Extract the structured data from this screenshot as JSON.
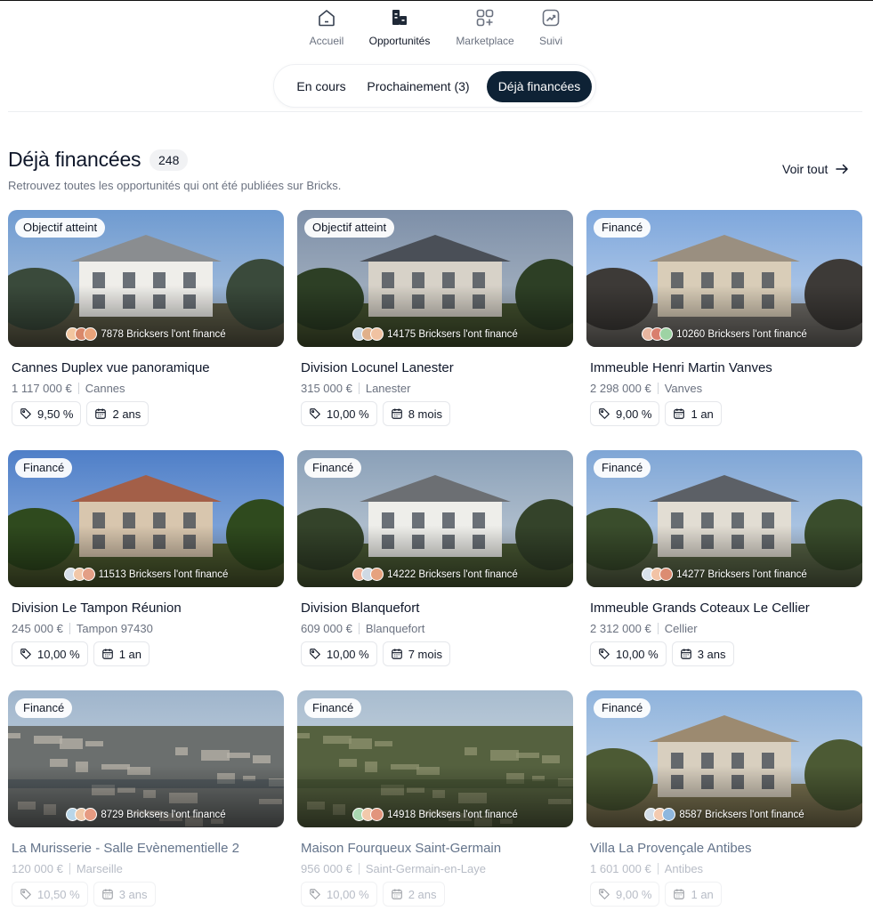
{
  "nav": {
    "items": [
      {
        "label": "Accueil",
        "icon": "home-icon"
      },
      {
        "label": "Opportunités",
        "icon": "opportunities-icon"
      },
      {
        "label": "Marketplace",
        "icon": "marketplace-icon"
      },
      {
        "label": "Suivi",
        "icon": "chart-icon"
      }
    ],
    "active": "Opportunités"
  },
  "tabs": [
    {
      "label": "En cours"
    },
    {
      "label": "Prochainement (3)"
    },
    {
      "label": "Déjà financées"
    }
  ],
  "active_tab": "Déjà financées",
  "section": {
    "title": "Déjà financées",
    "count": "248",
    "subtitle": "Retrouvez toutes les opportunités qui ont été publiées sur Bricks.",
    "see_all": "Voir tout"
  },
  "colors": {
    "accent_dark": "#0e2235",
    "muted_text": "#6b7280"
  },
  "cards": [
    {
      "badge": "Objectif atteint",
      "investors": "7878 Bricksers l'ont financé",
      "title": "Cannes Duplex vue panoramique",
      "price": "1 117 000 €",
      "location": "Cannes",
      "yield": "9,50 %",
      "duration": "2 ans"
    },
    {
      "badge": "Objectif atteint",
      "investors": "14175 Bricksers l'ont financé",
      "title": "Division Locunel Lanester",
      "price": "315 000 €",
      "location": "Lanester",
      "yield": "10,00 %",
      "duration": "8 mois"
    },
    {
      "badge": "Financé",
      "investors": "10260 Bricksers l'ont financé",
      "title": "Immeuble Henri Martin Vanves",
      "price": "2 298 000 €",
      "location": "Vanves",
      "yield": "9,00 %",
      "duration": "1 an"
    },
    {
      "badge": "Financé",
      "investors": "11513 Bricksers l'ont financé",
      "title": "Division Le Tampon Réunion",
      "price": "245 000 €",
      "location": "Tampon 97430",
      "yield": "10,00 %",
      "duration": "1 an"
    },
    {
      "badge": "Financé",
      "investors": "14222 Bricksers l'ont financé",
      "title": "Division Blanquefort",
      "price": "609 000 €",
      "location": "Blanquefort",
      "yield": "10,00 %",
      "duration": "7 mois"
    },
    {
      "badge": "Financé",
      "investors": "14277 Bricksers l'ont financé",
      "title": "Immeuble Grands Coteaux Le Cellier",
      "price": "2 312 000 €",
      "location": "Cellier",
      "yield": "10,00 %",
      "duration": "3 ans"
    },
    {
      "badge": "Financé",
      "investors": "8729 Bricksers l'ont financé",
      "title": "La Murisserie - Salle Evènementielle 2",
      "price": "120 000 €",
      "location": "Marseille",
      "yield": "10,50 %",
      "duration": "3 ans"
    },
    {
      "badge": "Financé",
      "investors": "14918 Bricksers l'ont financé",
      "title": "Maison Fourqueux Saint-Germain",
      "price": "956 000 €",
      "location": "Saint-Germain-en-Laye",
      "yield": "10,00 %",
      "duration": "2 ans"
    },
    {
      "badge": "Financé",
      "investors": "8587 Bricksers l'ont financé",
      "title": "Villa La Provençale Antibes",
      "price": "1 601 000 €",
      "location": "Antibes",
      "yield": "9,00 %",
      "duration": "1 an"
    }
  ]
}
